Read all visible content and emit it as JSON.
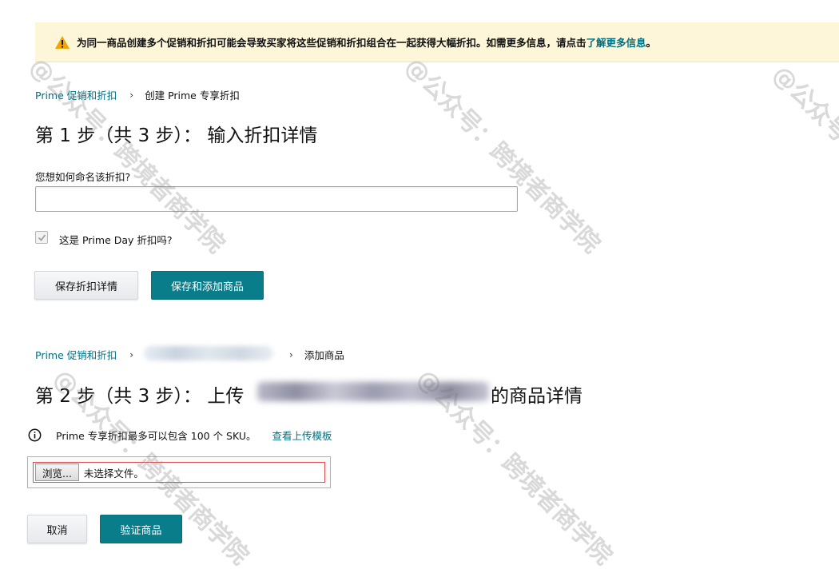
{
  "banner": {
    "icon": "warning-icon",
    "text": "为同一商品创建多个促销和折扣可能会导致买家将这些促销和折扣组合在一起获得大幅折扣。如需更多信息，请点击",
    "link": "了解更多信息",
    "suffix": "。"
  },
  "step1": {
    "breadcrumb": {
      "root": "Prime 促销和折扣",
      "separator": "›",
      "current": "创建 Prime 专享折扣"
    },
    "heading": "第 1 步（共 3 步）：  输入折扣详情",
    "name_label": "您想如何命名该折扣?",
    "name_value": "",
    "prime_day_label": "这是 Prime Day 折扣吗?",
    "prime_day_checked": true,
    "save_label": "保存折扣详情",
    "save_add_label": "保存和添加商品"
  },
  "step2": {
    "breadcrumb": {
      "root": "Prime 促销和折扣",
      "separator": "›",
      "current": "添加商品"
    },
    "heading_prefix": "第 2 步（共 3 步）：  上传",
    "heading_suffix": "的商品详情",
    "info_text": "Prime 专享折扣最多可以包含 100 个 SKU。",
    "template_link": "查看上传模板",
    "browse_label": "浏览...",
    "file_status": "未选择文件。",
    "cancel_label": "取消",
    "verify_label": "验证商品"
  },
  "watermarks": [
    "@公众号：跨境者商学院",
    "@公众号：跨境者商学院",
    "@公众号：跨境者商学院",
    "@公众号：跨境者商学院",
    "@公众号：跨境者商学院"
  ],
  "colors": {
    "link": "#007185",
    "primary_button": "#0a7d8a",
    "banner_bg": "#fdf6d9",
    "warning": "#f0a500",
    "file_error_border": "#e24b4b"
  }
}
